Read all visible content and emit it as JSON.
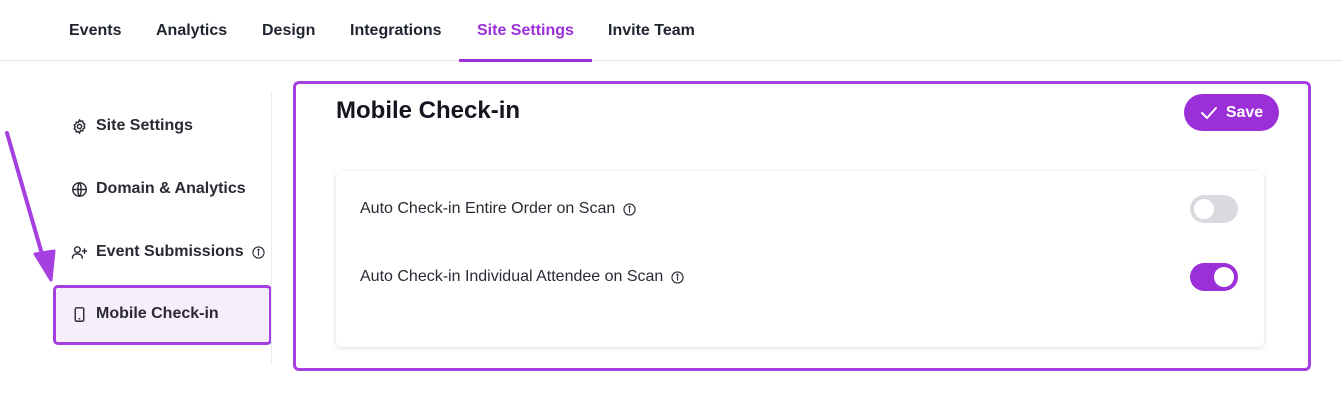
{
  "nav": {
    "tabs": [
      {
        "label": "Events"
      },
      {
        "label": "Analytics"
      },
      {
        "label": "Design"
      },
      {
        "label": "Integrations"
      },
      {
        "label": "Site Settings",
        "active": true
      },
      {
        "label": "Invite Team"
      }
    ]
  },
  "sidebar": {
    "items": [
      {
        "label": "Site Settings",
        "icon": "gear-icon"
      },
      {
        "label": "Domain & Analytics",
        "icon": "globe-icon"
      },
      {
        "label": "Event Submissions",
        "icon": "user-plus-icon",
        "info": true
      },
      {
        "label": "Mobile Check-in",
        "icon": "mobile-icon",
        "active": true
      }
    ]
  },
  "main": {
    "title": "Mobile Check-in",
    "save_label": "Save",
    "settings": [
      {
        "label": "Auto Check-in Entire Order on Scan",
        "enabled": false
      },
      {
        "label": "Auto Check-in Individual Attendee on Scan",
        "enabled": true
      }
    ]
  },
  "colors": {
    "accent": "#9b2fd8",
    "highlight": "#a53fe0",
    "toggle_off": "#d9dadf"
  }
}
